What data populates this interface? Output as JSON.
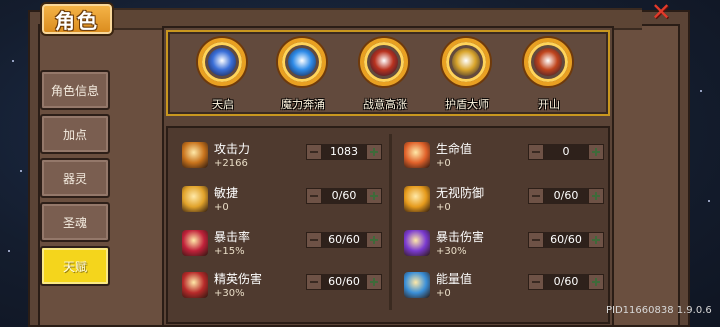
{
  "window": {
    "title": "角色",
    "close_label": "✕"
  },
  "sidebar": {
    "items": [
      {
        "label": "角色信息",
        "active": false
      },
      {
        "label": "加点",
        "active": false
      },
      {
        "label": "器灵",
        "active": false
      },
      {
        "label": "圣魂",
        "active": false
      },
      {
        "label": "天赋",
        "active": true
      }
    ]
  },
  "skills": [
    {
      "label": "天启",
      "icon": "spirit-orb-icon",
      "color": "#3a6fd8"
    },
    {
      "label": "魔力奔涌",
      "icon": "mana-surge-icon",
      "color": "#2e8be8"
    },
    {
      "label": "战意高涨",
      "icon": "war-spirit-icon",
      "color": "#b8321f"
    },
    {
      "label": "护盾大师",
      "icon": "shield-master-icon",
      "color": "#d9a52c"
    },
    {
      "label": "开山",
      "icon": "mountain-split-icon",
      "color": "#c0451d"
    }
  ],
  "stats": [
    {
      "name": "攻击力",
      "bonus": "+2166",
      "value": "1083",
      "icon": "sword-icon",
      "color": "#c8731c"
    },
    {
      "name": "生命值",
      "bonus": "+0",
      "value": "0",
      "icon": "heart-icon",
      "color": "#e0612a"
    },
    {
      "name": "敏捷",
      "bonus": "+0",
      "value": "0/60",
      "icon": "agility-icon",
      "color": "#e0a22a"
    },
    {
      "name": "无视防御",
      "bonus": "+0",
      "value": "0/60",
      "icon": "pierce-shield-icon",
      "color": "#e59a1c"
    },
    {
      "name": "暴击率",
      "bonus": "+15%",
      "value": "60/60",
      "icon": "crit-rate-icon",
      "color": "#c0213a"
    },
    {
      "name": "暴击伤害",
      "bonus": "+30%",
      "value": "60/60",
      "icon": "crit-damage-icon",
      "color": "#7a3ad0"
    },
    {
      "name": "精英伤害",
      "bonus": "+30%",
      "value": "60/60",
      "icon": "elite-damage-icon",
      "color": "#b82a2a"
    },
    {
      "name": "能量值",
      "bonus": "+0",
      "value": "0/60",
      "icon": "energy-icon",
      "color": "#3a8fd8"
    }
  ],
  "version_text": "PID11660838 1.9.0.6"
}
